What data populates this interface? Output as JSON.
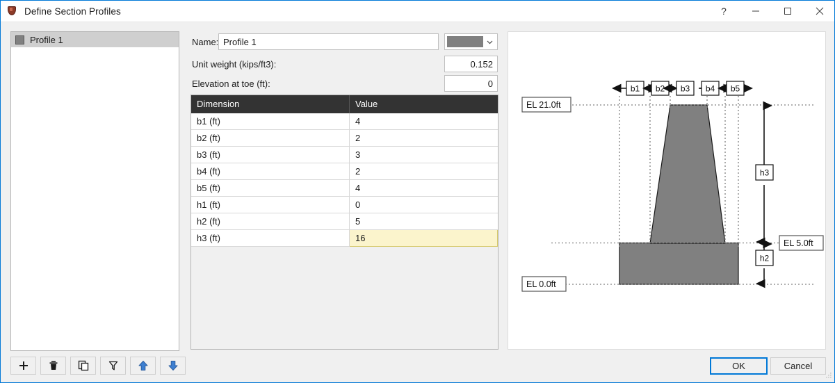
{
  "window": {
    "title": "Define Section Profiles",
    "icon": "shield-icon",
    "controls": {
      "help": "?",
      "minimize": "minimize-icon",
      "maximize": "maximize-icon",
      "close": "close-icon"
    }
  },
  "sidebar": {
    "items": [
      {
        "label": "Profile 1",
        "color": "#808080",
        "selected": true
      }
    ],
    "toolbar": [
      {
        "name": "add-profile-button",
        "icon": "plus-icon"
      },
      {
        "name": "delete-profile-button",
        "icon": "trash-icon"
      },
      {
        "name": "duplicate-profile-button",
        "icon": "copy-icon"
      },
      {
        "name": "filter-profile-button",
        "icon": "funnel-icon"
      },
      {
        "name": "move-up-button",
        "icon": "arrow-up-icon"
      },
      {
        "name": "move-down-button",
        "icon": "arrow-down-icon"
      }
    ]
  },
  "form": {
    "name_label": "Name:",
    "name_value": "Profile 1",
    "color_value": "#808080",
    "unit_weight_label": "Unit weight (kips/ft3):",
    "unit_weight_value": "0.152",
    "elevation_label": "Elevation at toe (ft):",
    "elevation_value": "0"
  },
  "table": {
    "headers": [
      "Dimension",
      "Value"
    ],
    "rows": [
      {
        "dimension": "b1 (ft)",
        "value": "4",
        "highlight": false
      },
      {
        "dimension": "b2 (ft)",
        "value": "2",
        "highlight": false
      },
      {
        "dimension": "b3 (ft)",
        "value": "3",
        "highlight": false
      },
      {
        "dimension": "b4 (ft)",
        "value": "2",
        "highlight": false
      },
      {
        "dimension": "b5 (ft)",
        "value": "4",
        "highlight": false
      },
      {
        "dimension": "h1 (ft)",
        "value": "0",
        "highlight": false
      },
      {
        "dimension": "h2 (ft)",
        "value": "5",
        "highlight": false
      },
      {
        "dimension": "h3 (ft)",
        "value": "16",
        "highlight": true
      }
    ]
  },
  "diagram": {
    "width_callouts": [
      "b1",
      "b2",
      "b3",
      "b4",
      "b5"
    ],
    "height_callouts": [
      "h3",
      "h2"
    ],
    "elevation_labels": {
      "top": "EL 21.0ft",
      "mid": "EL 5.0ft",
      "bottom": "EL 0.0ft"
    },
    "fill_color": "#808080",
    "stroke_color": "#1a1a1a"
  },
  "footer": {
    "ok_label": "OK",
    "cancel_label": "Cancel"
  }
}
